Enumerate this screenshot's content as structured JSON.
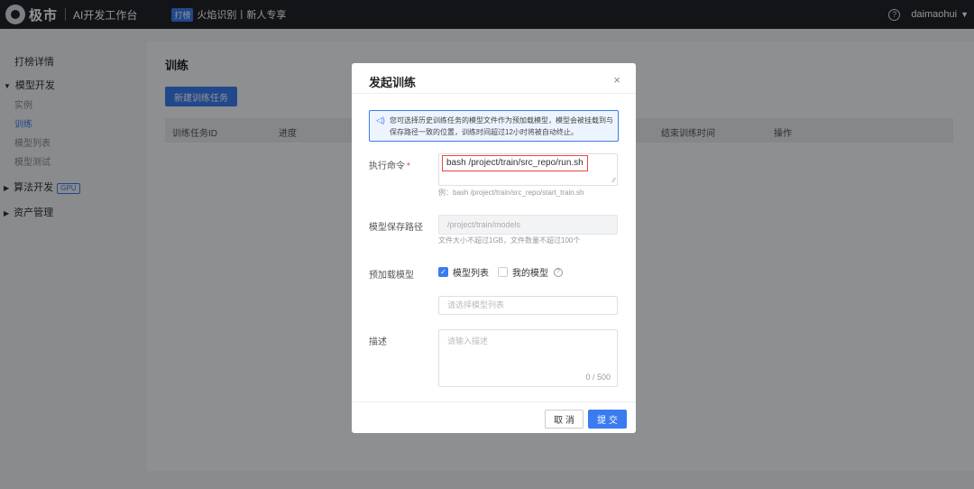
{
  "topbar": {
    "brand": "极市",
    "app_title": "AI开发工作台",
    "promo_badge": "打榜",
    "promo_text": "火焰识别丨新人专享",
    "help_symbol": "?",
    "user_name": "daimaohui"
  },
  "sidebar": {
    "item_leaderboard": "打榜详情",
    "group_model": "模型开发",
    "sub_instance": "实例",
    "sub_train": "训练",
    "sub_model_list": "模型列表",
    "sub_model_test": "模型测试",
    "group_algo": "算法开发",
    "gpu_badge": "GPU",
    "group_assets": "资产管理"
  },
  "main": {
    "title": "训练",
    "new_button": "新建训练任务",
    "columns": [
      "训练任务ID",
      "进度",
      "结束训练时间",
      "操作"
    ]
  },
  "modal": {
    "title": "发起训练",
    "close_symbol": "×",
    "notice": "您可选择历史训练任务的模型文件作为预加载模型，模型会被挂载到与保存路径一致的位置，训练时间超过12小时将被自动终止。",
    "cmd_label": "执行命令",
    "required_mark": "*",
    "cmd_value": "bash /project/train/src_repo/run.sh",
    "cmd_hint": "例：bash /project/train/src_repo/start_train.sh",
    "path_label": "模型保存路径",
    "path_value": "/project/train/models",
    "path_hint": "文件大小不超过1GB，文件数量不超过100个",
    "preload_label": "预加载模型",
    "opt_model_list": "模型列表",
    "opt_my_model": "我的模型",
    "select_placeholder": "请选择模型列表",
    "desc_label": "描述",
    "desc_placeholder": "请输入描述",
    "counter": "0 / 500",
    "cancel": "取 消",
    "submit": "提 交"
  }
}
